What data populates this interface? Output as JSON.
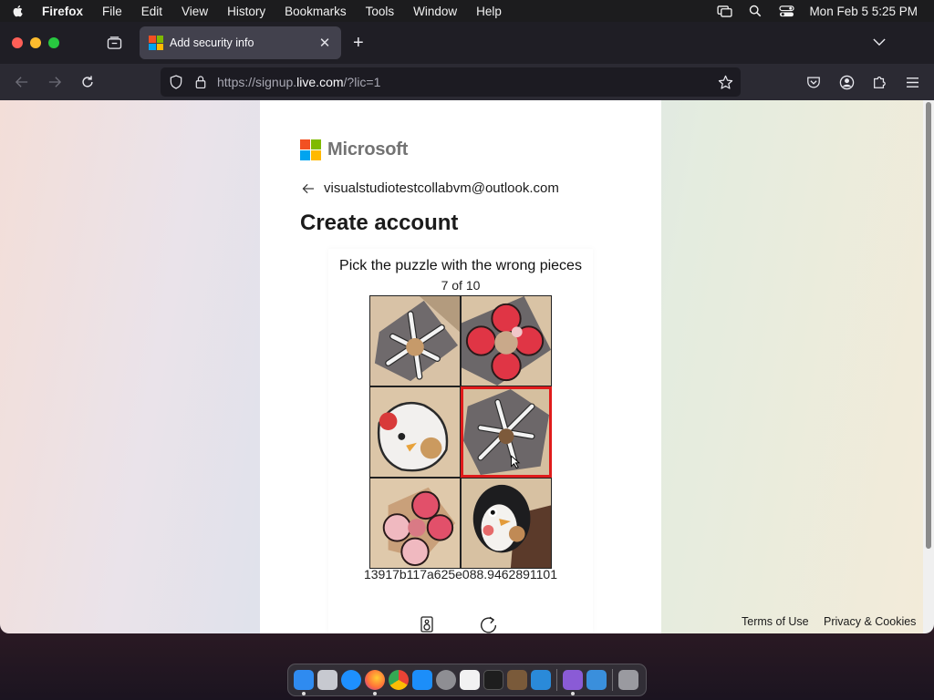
{
  "menubar": {
    "app_name": "Firefox",
    "menus": [
      "File",
      "Edit",
      "View",
      "History",
      "Bookmarks",
      "Tools",
      "Window",
      "Help"
    ],
    "clock": "Mon Feb 5  5:25 PM",
    "status_icons": [
      "screen-mirroring-icon",
      "spotlight-search-icon",
      "control-center-icon"
    ]
  },
  "browser": {
    "tab": {
      "title": "Add security info",
      "favicon": "microsoft-logo-icon"
    },
    "url": {
      "prefix": "https://signup.",
      "host": "live.com",
      "suffix": "/?lic=1"
    }
  },
  "page": {
    "brand": "Microsoft",
    "brand_colors": [
      "#f25022",
      "#7fba00",
      "#00a4ef",
      "#ffb900"
    ],
    "identity_email": "visualstudiotestcollabvm@outlook.com",
    "heading": "Create account",
    "captcha": {
      "prompt": "Pick the puzzle with the wrong pieces",
      "progress": "7 of 10",
      "selected_index": 3,
      "tiles": [
        {
          "motif": "white-black snowflake on grey"
        },
        {
          "motif": "red flower on grey"
        },
        {
          "motif": "white cartoon chicken"
        },
        {
          "motif": "white-black snowflake on grey"
        },
        {
          "motif": "red-pink flower"
        },
        {
          "motif": "black-white cartoon penguin"
        }
      ],
      "code": "13917b117a625e088.9462891101",
      "selection_color": "#e01b1b"
    },
    "footer": {
      "terms": "Terms of Use",
      "privacy": "Privacy & Cookies"
    }
  },
  "dock": {
    "apps": [
      {
        "name": "finder-icon",
        "color": "#2f8bf0"
      },
      {
        "name": "launchpad-icon",
        "color": "#c7c9d0"
      },
      {
        "name": "safari-icon",
        "color": "#1e90ff"
      },
      {
        "name": "firefox-icon",
        "color": "#ff7139"
      },
      {
        "name": "chrome-icon",
        "color": "#34a853"
      },
      {
        "name": "app-store-icon",
        "color": "#1c8ef9"
      },
      {
        "name": "system-settings-icon",
        "color": "#8e8e93"
      },
      {
        "name": "textedit-icon",
        "color": "#f2f2f2"
      },
      {
        "name": "terminal-icon",
        "color": "#1e1e1e"
      },
      {
        "name": "paint-icon",
        "color": "#7a5a3a"
      },
      {
        "name": "vscode-icon",
        "color": "#2a8ad9"
      },
      {
        "name": "visual-studio-icon",
        "color": "#8a5bd6"
      },
      {
        "name": "cloud-drive-icon",
        "color": "#3a8fdc"
      },
      {
        "name": "trash-icon",
        "color": "#9a9aa0"
      }
    ]
  }
}
